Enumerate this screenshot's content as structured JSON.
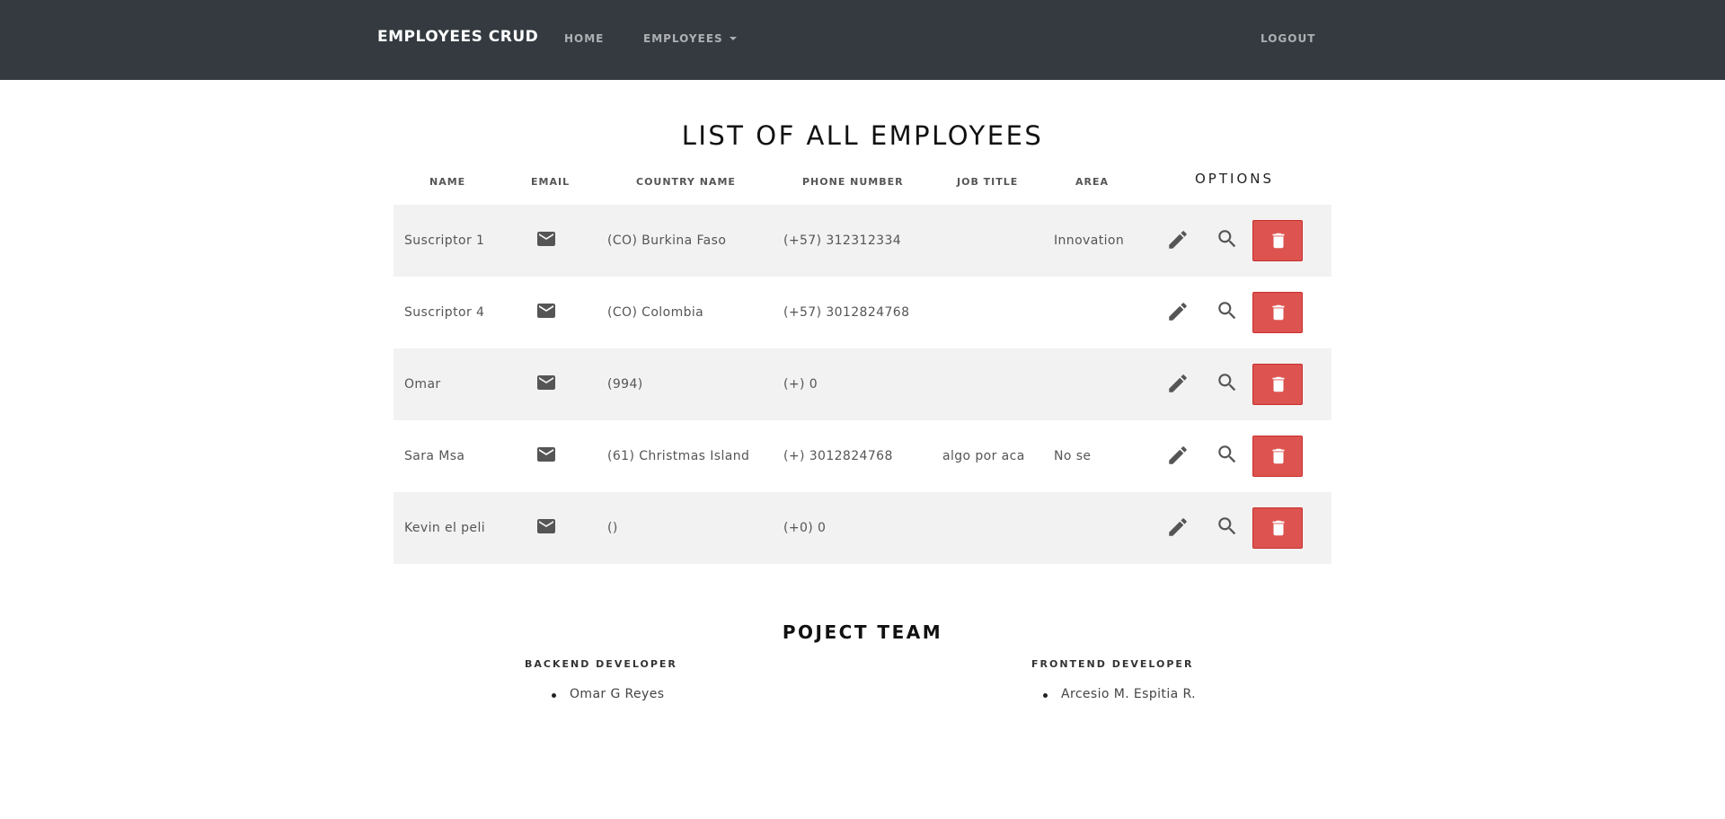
{
  "navbar": {
    "brand": "EMPLOYEES CRUD",
    "home": "HOME",
    "employees": "EMPLOYEES",
    "logout": "LOGOUT"
  },
  "page": {
    "title": "LIST OF ALL EMPLOYEES"
  },
  "table": {
    "headers": {
      "name": "NAME",
      "email": "EMAIL",
      "country": "COUNTRY NAME",
      "phone": "PHONE NUMBER",
      "job": "JOB TITLE",
      "area": "AREA",
      "options": "OPTIONS"
    },
    "rows": [
      {
        "name": "Suscriptor 1",
        "country": "(CO) Burkina Faso",
        "phone": "(+57) 312312334",
        "job": "",
        "area": "Innovation"
      },
      {
        "name": "Suscriptor 4",
        "country": "(CO) Colombia",
        "phone": "(+57) 3012824768",
        "job": "",
        "area": ""
      },
      {
        "name": "Omar",
        "country": "(994)",
        "phone": "(+) 0",
        "job": "",
        "area": ""
      },
      {
        "name": "Sara Msa",
        "country": "(61) Christmas Island",
        "phone": "(+) 3012824768",
        "job": "algo por aca",
        "area": "No se"
      },
      {
        "name": "Kevin el peli",
        "country": "()",
        "phone": "(+0) 0",
        "job": "",
        "area": ""
      }
    ],
    "icons": {
      "email": "envelope-icon",
      "edit": "pencil-icon",
      "view": "magnifier-icon",
      "delete": "trash-icon"
    }
  },
  "team": {
    "title": "POJECT TEAM",
    "backend_role": "BACKEND DEVELOPER",
    "backend_member": "Omar G Reyes",
    "frontend_role": "FRONTEND DEVELOPER",
    "frontend_member": "Arcesio M. Espitia R."
  },
  "colors": {
    "navbar": "#343a40",
    "delete": "#dc5350",
    "row_alt": "#f2f2f2"
  }
}
